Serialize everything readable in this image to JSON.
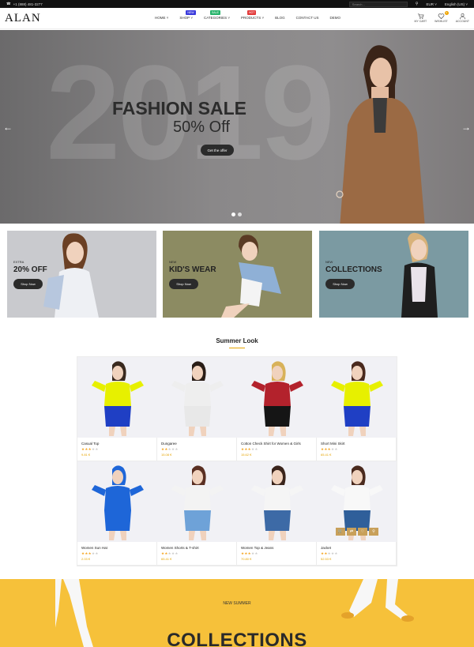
{
  "topbar": {
    "phone": "+1 (888) 481-3277",
    "search_placeholder": "Search...",
    "currency": "EUR ˅",
    "language": "English (US) ˅"
  },
  "header": {
    "logo": "ALAN",
    "nav": [
      {
        "label": "HOME ˅",
        "badge": ""
      },
      {
        "label": "SHOP ˅",
        "badge": "NEW",
        "badge_color": "#3b3bdc"
      },
      {
        "label": "CATEGORIES ˅",
        "badge": "SALE",
        "badge_color": "#27b36a"
      },
      {
        "label": "PRODUCTS ˅",
        "badge": "HOT",
        "badge_color": "#e23b3b"
      },
      {
        "label": "BLOG",
        "badge": ""
      },
      {
        "label": "CONTACT US",
        "badge": ""
      },
      {
        "label": "DEMO",
        "badge": ""
      }
    ],
    "cart_label": "MY CART",
    "wishlist_label": "WISHLIST",
    "wishlist_count": "0",
    "account_label": "ACCOUNT"
  },
  "hero": {
    "year": "2019",
    "title": "FASHION SALE",
    "subtitle": "50% Off",
    "button": "Get the offer"
  },
  "banners": [
    {
      "tag": "EXTRA",
      "title": "20% OFF",
      "button": "Shop Now",
      "bg": "#c9cace"
    },
    {
      "tag": "NEW",
      "title": "KID'S WEAR",
      "button": "Shop Now",
      "bg": "#8c8b62"
    },
    {
      "tag": "NEW",
      "title": "COLLECTIONS",
      "button": "Shop Now",
      "bg": "#7b9aa2"
    }
  ],
  "section": {
    "title": "Summer Look"
  },
  "products": [
    {
      "name": "Casual Top",
      "price": "9.81 €",
      "rating": 3,
      "top": "#e7f000",
      "bottom": "#1f3fc4",
      "hair": "#3a2a1f"
    },
    {
      "name": "Dungaree",
      "price": "15.08 €",
      "rating": 2,
      "top": "#eeeeee",
      "bottom": "#e8e8e8",
      "hair": "#2a1e17"
    },
    {
      "name": "Cotton Check Shirt for Women & Girls",
      "price": "15.62 €",
      "rating": 3,
      "top": "#b3222c",
      "bottom": "#151515",
      "hair": "#d8b25a"
    },
    {
      "name": "Short Mini Skirt",
      "price": "65.41 €",
      "rating": 3,
      "top": "#e7f000",
      "bottom": "#1f3fc4",
      "hair": "#4a2a1e"
    },
    {
      "name": "Women Sun Hat",
      "price": "2.03 €",
      "rating": 3,
      "top": "#1e66d8",
      "bottom": "#1e66d8",
      "hair": "#1e66d8"
    },
    {
      "name": "Women Shorts & T-shirt",
      "price": "65.41 €",
      "rating": 2,
      "top": "#f3f3f3",
      "bottom": "#6ea2d8",
      "hair": "#5a2f22"
    },
    {
      "name": "Women Top & Jeans",
      "price": "70.80 €",
      "rating": 3,
      "top": "#f5f5f5",
      "bottom": "#3d6aa6",
      "hair": "#3a241b"
    },
    {
      "name": "Jacket",
      "price": "52.53 €",
      "rating": 2,
      "top": "#f8f8f8",
      "bottom": "#2f5f9a",
      "hair": "#4a2a1e"
    }
  ],
  "promo": {
    "subtitle": "NEW SUMMER",
    "title": "COLLECTIONS"
  }
}
